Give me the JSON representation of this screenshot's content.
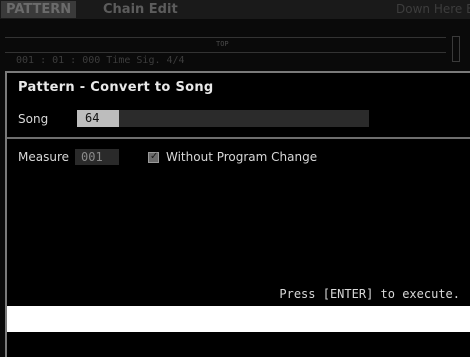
{
  "background": {
    "mode_tag": "PATTERN",
    "title": "Chain Edit",
    "header_right": "Down Here  E",
    "track_label": "TOP",
    "row_text": "001 : 01 : 000   Time Sig.      4/4"
  },
  "dialog": {
    "title": "Pattern - Convert to Song",
    "song_label": "Song",
    "song_value": "64",
    "measure_label": "Measure",
    "measure_value": "001",
    "checkbox_label": "Without Program Change",
    "checkbox_checked": true,
    "press_text": "Press [ENTER] to execute."
  },
  "colors": {
    "dialog_bg": "#000000",
    "dialog_border": "#7a7a7a",
    "text": "#d8d8d8",
    "value_highlight": "#bdbdbd"
  }
}
